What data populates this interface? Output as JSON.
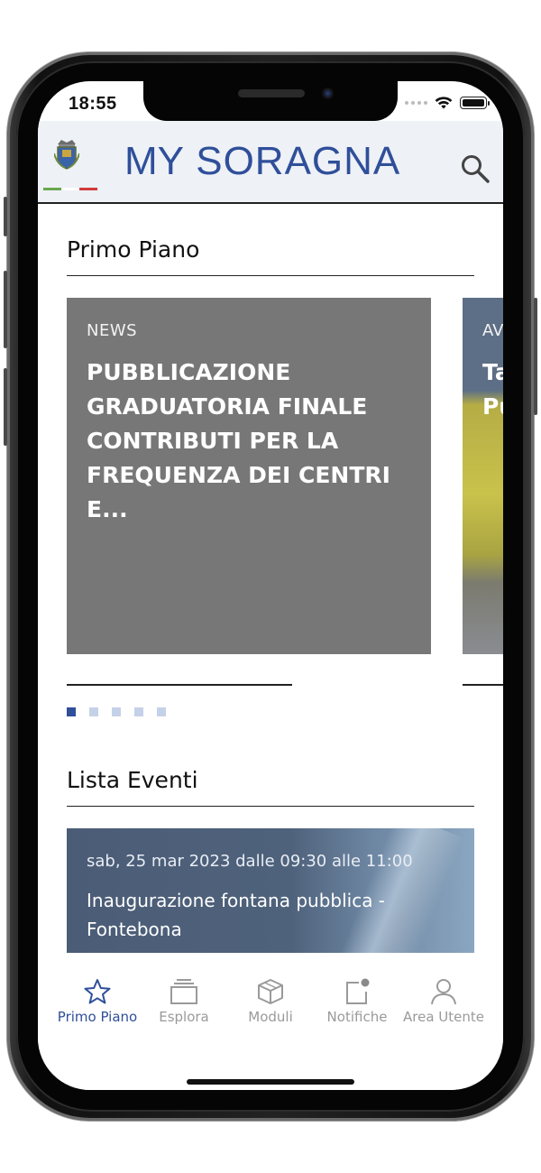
{
  "status_bar": {
    "time": "18:55"
  },
  "header": {
    "brand_my": "MY",
    "brand_name": "SORAGNA",
    "brand_color": "#2f4f9a",
    "search_icon": "search-icon",
    "crest_icon": "municipal-crest-icon"
  },
  "primo_piano": {
    "title": "Primo Piano",
    "cards": [
      {
        "category": "NEWS",
        "title": "PUBBLICAZIONE GRADUATORIA FINALE CONTRIBUTI PER LA FREQUENZA DEI CENTRI E..."
      },
      {
        "category": "AV",
        "title": "Ta Pu"
      }
    ],
    "pager": {
      "count": 5,
      "active": 1
    }
  },
  "lista_eventi": {
    "title": "Lista Eventi",
    "events": [
      {
        "date": "sab, 25 mar 2023 dalle 09:30 alle 11:00",
        "title": "Inaugurazione fontana pubblica - Fontebona"
      }
    ]
  },
  "tabbar": {
    "tabs": [
      {
        "label": "Primo Piano",
        "icon": "star-icon",
        "active": true
      },
      {
        "label": "Esplora",
        "icon": "stack-icon",
        "active": false
      },
      {
        "label": "Moduli",
        "icon": "cube-icon",
        "active": false
      },
      {
        "label": "Notifiche",
        "icon": "notification-icon",
        "active": false
      },
      {
        "label": "Area Utente",
        "icon": "user-icon",
        "active": false
      }
    ],
    "active_color": "#2f4f9a",
    "inactive_color": "#9a9a9a"
  }
}
